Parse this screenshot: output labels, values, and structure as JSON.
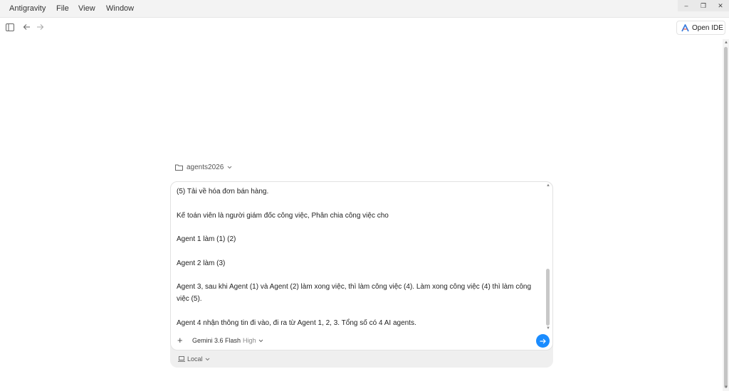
{
  "menubar": {
    "items": [
      "Antigravity",
      "File",
      "View",
      "Window"
    ]
  },
  "window_controls": {
    "minimize": "–",
    "restore": "❐",
    "close": "✕"
  },
  "toolbar": {
    "sidebar_icon": "sidebar-toggle-icon",
    "back_icon": "arrow-left-icon",
    "forward_icon": "arrow-right-icon",
    "open_ide_label": "Open IDE"
  },
  "workspace": {
    "name": "agents2026"
  },
  "composer": {
    "lines": [
      "(5) Tải về hóa đơn bán hàng.",
      "",
      "Kế toán viên là người giám đốc công việc, Phân chia công việc cho",
      "",
      "Agent 1 làm (1) (2)",
      "",
      "Agent 2 làm (3)",
      "",
      "Agent 3, sau khi Agent (1) và Agent (2) làm xong việc, thì làm công việc (4). Làm xong công việc (4) thì làm công việc (5).",
      "",
      "Agent 4 nhận thông tin đi vào, đi ra từ Agent 1, 2, 3. Tổng số có 4 AI agents."
    ],
    "add_label": "+",
    "model_name": "Gemini 3.6 Flash",
    "model_level": "High",
    "environment": "Local"
  },
  "colors": {
    "accent": "#1a8cff"
  }
}
